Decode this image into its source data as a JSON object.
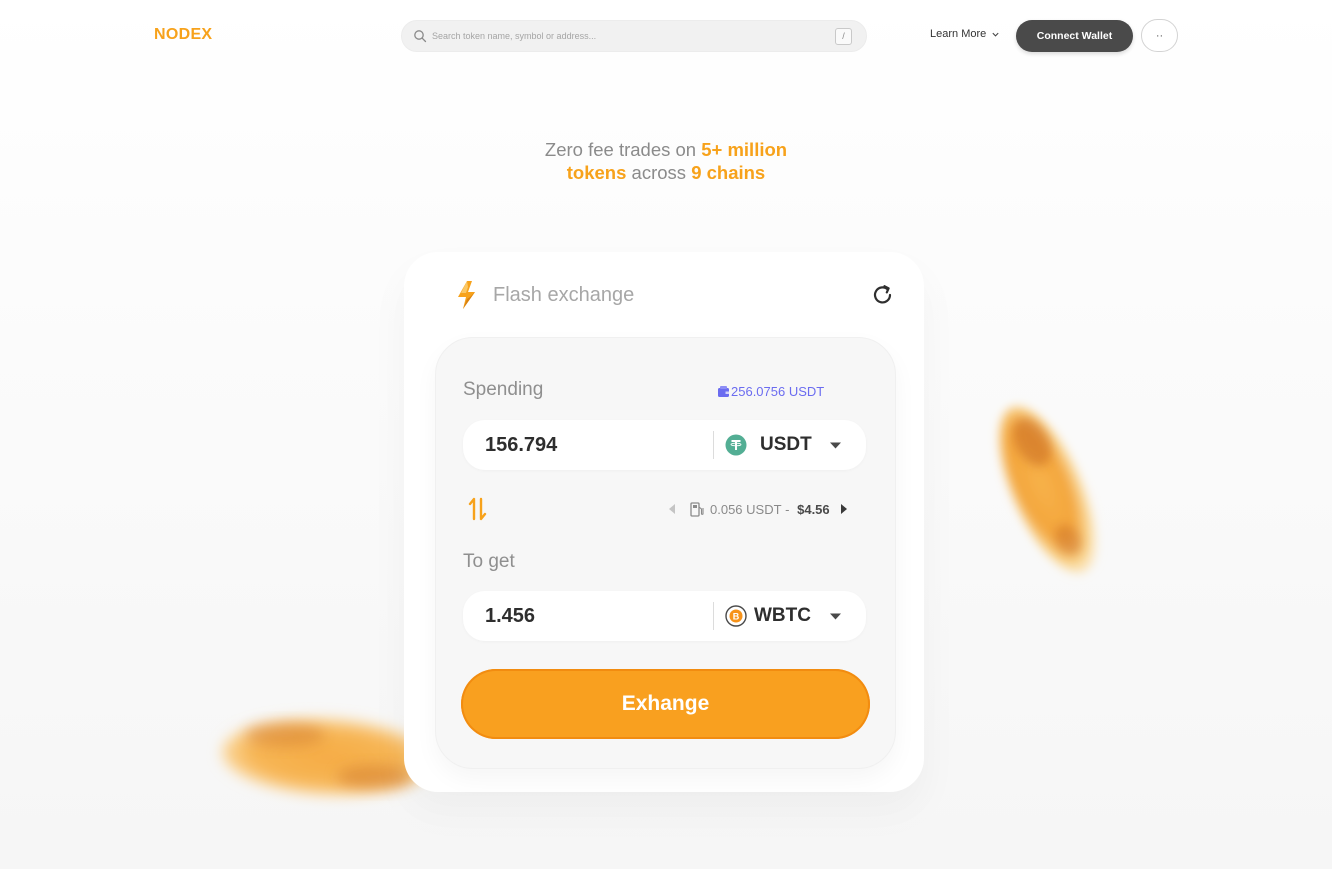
{
  "header": {
    "logo": "NODEX",
    "search_placeholder": "Search token name, symbol or address...",
    "search_shortcut": "/",
    "learn_more": "Learn More",
    "connect_wallet": "Connect Wallet",
    "more": "··"
  },
  "hero": {
    "part1": "Zero fee trades on ",
    "highlight1": "5+ million",
    "highlight2": "tokens",
    "part2": " across ",
    "highlight3": "9 chains"
  },
  "exchange": {
    "title": "Flash exchange",
    "spending_label": "Spending",
    "balance": "256.0756 USDT",
    "spend_value": "156.794",
    "spend_token": "USDT",
    "fee_text": "0.056 USDT",
    "fee_sep": " - ",
    "fee_usd": "$4.56",
    "get_label": "To get",
    "get_value": "1.456",
    "get_token": "WBTC",
    "button": "Exhange"
  },
  "colors": {
    "accent": "#f9a01f",
    "brand": "#f7a21b",
    "balance": "#6b6cf0",
    "usdt": "#53ae94",
    "dark_button": "#4a4a4a"
  }
}
